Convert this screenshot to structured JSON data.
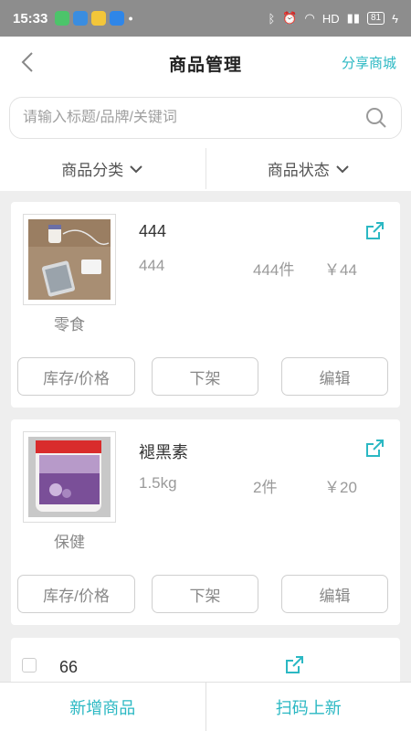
{
  "status": {
    "time": "15:33",
    "network": "HD",
    "battery": "81"
  },
  "header": {
    "title": "商品管理",
    "share_mall": "分享商城"
  },
  "search": {
    "placeholder": "请输入标题/品牌/关键词"
  },
  "filters": {
    "category": "商品分类",
    "status": "商品状态"
  },
  "products": [
    {
      "name": "444",
      "spec": "444",
      "stock": "444件",
      "price": "￥44",
      "category": "零食"
    },
    {
      "name": "褪黑素",
      "spec": "1.5kg",
      "stock": "2件",
      "price": "￥20",
      "category": "保健"
    },
    {
      "name": "66"
    }
  ],
  "actions": {
    "stock_price": "库存/价格",
    "unlist": "下架",
    "edit": "编辑"
  },
  "bottom": {
    "add": "新增商品",
    "scan": "扫码上新"
  },
  "colors": {
    "accent": "#2bb8c3",
    "status_bar": "#8d8d8d",
    "background": "#eeeeee"
  },
  "icons": {
    "back": "chevron-left-icon",
    "search": "search-icon",
    "dropdown": "chevron-down-icon",
    "share": "share-icon"
  }
}
